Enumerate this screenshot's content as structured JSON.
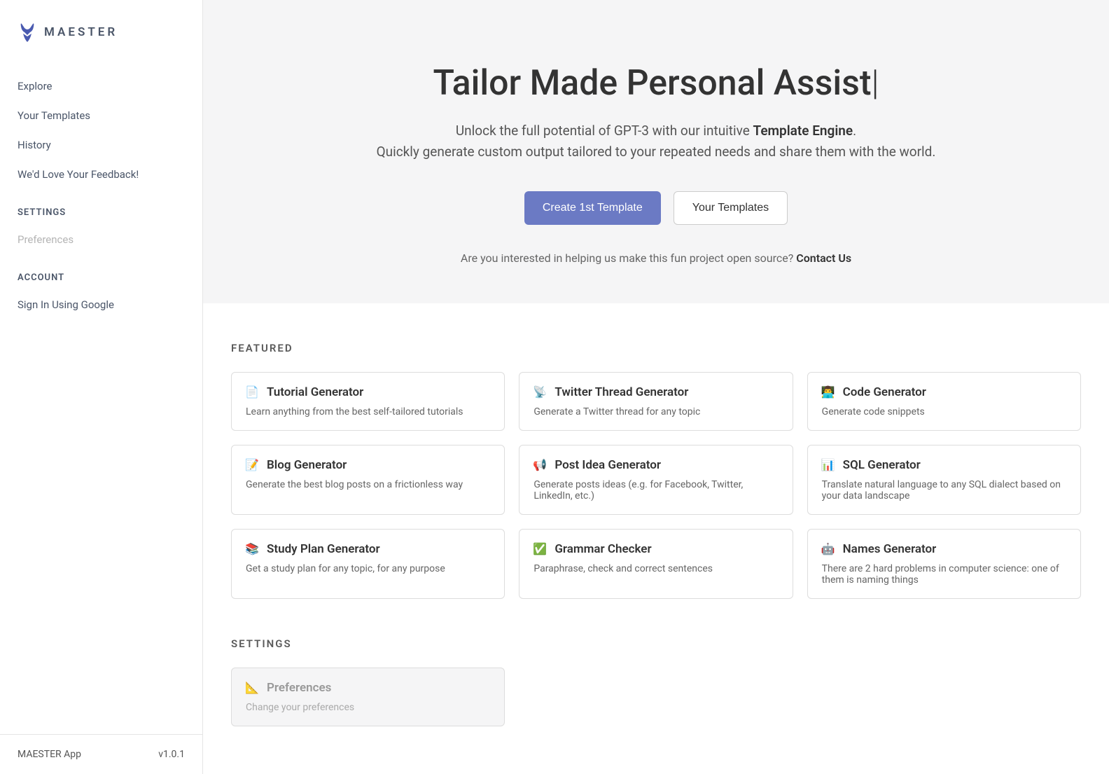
{
  "brand": {
    "name": "MAESTER"
  },
  "sidebar": {
    "nav": [
      {
        "label": "Explore"
      },
      {
        "label": "Your Templates"
      },
      {
        "label": "History"
      },
      {
        "label": "We'd Love Your Feedback!"
      }
    ],
    "settings_header": "SETTINGS",
    "settings_items": [
      {
        "label": "Preferences"
      }
    ],
    "account_header": "ACCOUNT",
    "account_items": [
      {
        "label": "Sign In Using Google"
      }
    ],
    "footer": {
      "app": "MAESTER App",
      "version": "v1.0.1"
    }
  },
  "hero": {
    "title": "Tailor Made Personal Assist",
    "cursor": "|",
    "subtitle_prefix": "Unlock the full potential of GPT-3 with our intuitive ",
    "subtitle_strong": "Template Engine",
    "subtitle_line2": "Quickly generate custom output tailored to your repeated needs and share them with the world.",
    "btn_primary": "Create 1st Template",
    "btn_secondary": "Your Templates",
    "open_source_prefix": "Are you interested in helping us make this fun project open source? ",
    "contact_us": "Contact Us"
  },
  "featured": {
    "title": "FEATURED",
    "cards": [
      {
        "icon": "📄",
        "title": "Tutorial Generator",
        "description": "Learn anything from the best self-tailored tutorials"
      },
      {
        "icon": "📡",
        "title": "Twitter Thread Generator",
        "description": "Generate a Twitter thread for any topic"
      },
      {
        "icon": "👨‍💻",
        "title": "Code Generator",
        "description": "Generate code snippets"
      },
      {
        "icon": "📝",
        "title": "Blog Generator",
        "description": "Generate the best blog posts on a frictionless way"
      },
      {
        "icon": "📢",
        "title": "Post Idea Generator",
        "description": "Generate posts ideas (e.g. for Facebook, Twitter, LinkedIn, etc.)"
      },
      {
        "icon": "📊",
        "title": "SQL Generator",
        "description": "Translate natural language to any SQL dialect based on your data landscape"
      },
      {
        "icon": "📚",
        "title": "Study Plan Generator",
        "description": "Get a study plan for any topic, for any purpose"
      },
      {
        "icon": "✅",
        "title": "Grammar Checker",
        "description": "Paraphrase, check and correct sentences"
      },
      {
        "icon": "🤖",
        "title": "Names Generator",
        "description": "There are 2 hard problems in computer science: one of them is naming things"
      }
    ]
  },
  "settings_section": {
    "title": "SETTINGS",
    "cards": [
      {
        "icon": "📐",
        "title": "Preferences",
        "description": "Change your preferences"
      }
    ]
  }
}
